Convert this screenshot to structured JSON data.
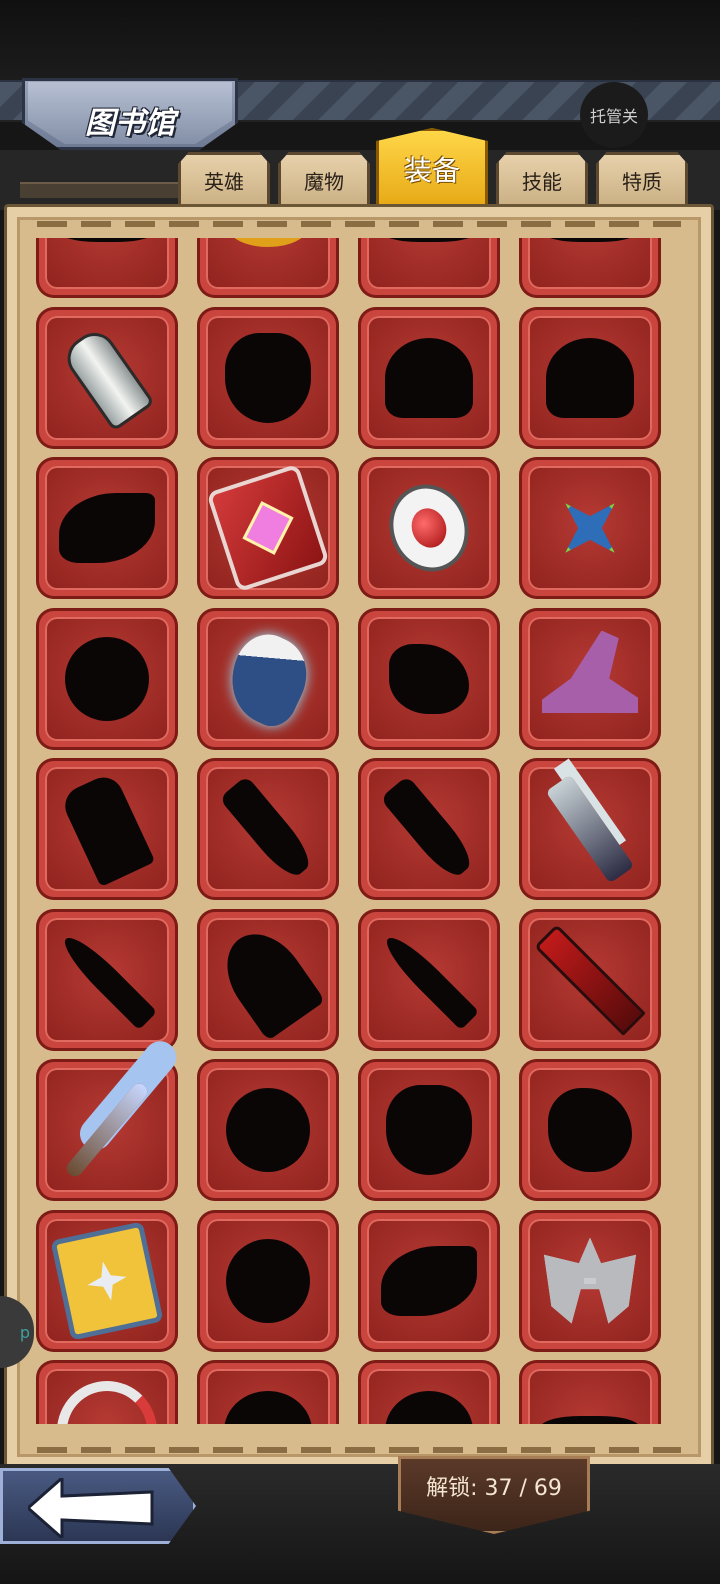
{
  "header": {
    "title": "图书馆",
    "auto_button": "托管关"
  },
  "tabs": [
    {
      "label": "英雄",
      "active": false
    },
    {
      "label": "魔物",
      "active": false
    },
    {
      "label": "装备",
      "active": true
    },
    {
      "label": "技能",
      "active": false
    },
    {
      "label": "特质",
      "active": false
    }
  ],
  "footer": {
    "unlock_label": "解锁: 37 / 69"
  },
  "side_widget": {
    "label": "p"
  },
  "colors": {
    "active_tab": "#f2c12e",
    "tile_red": "#c9453d",
    "panel": "#d8bb8c"
  },
  "grid": {
    "columns": 4,
    "items": [
      {
        "icon": "silhouette-flat",
        "unlocked": false
      },
      {
        "icon": "gold-item",
        "unlocked": true
      },
      {
        "icon": "silhouette-flat",
        "unlocked": false
      },
      {
        "icon": "silhouette-flat",
        "unlocked": false
      },
      {
        "icon": "bell-item",
        "unlocked": true
      },
      {
        "icon": "silhouette-bag",
        "unlocked": false
      },
      {
        "icon": "silhouette-helm",
        "unlocked": false
      },
      {
        "icon": "silhouette-helm",
        "unlocked": false
      },
      {
        "icon": "silhouette-horn",
        "unlocked": false
      },
      {
        "icon": "spellbook-item",
        "unlocked": true
      },
      {
        "icon": "ruby-amulet-item",
        "unlocked": true
      },
      {
        "icon": "shuriken-staff-item",
        "unlocked": true
      },
      {
        "icon": "silhouette-round",
        "unlocked": false
      },
      {
        "icon": "frost-gauntlet-item",
        "unlocked": true
      },
      {
        "icon": "silhouette-glove",
        "unlocked": false
      },
      {
        "icon": "wizard-hat-item",
        "unlocked": true
      },
      {
        "icon": "silhouette-hammer",
        "unlocked": false
      },
      {
        "icon": "silhouette-blade",
        "unlocked": false
      },
      {
        "icon": "silhouette-blade",
        "unlocked": false
      },
      {
        "icon": "skull-scythe-item",
        "unlocked": true
      },
      {
        "icon": "silhouette-spear",
        "unlocked": false
      },
      {
        "icon": "silhouette-axe",
        "unlocked": false
      },
      {
        "icon": "silhouette-spear",
        "unlocked": false
      },
      {
        "icon": "crimson-sword-item",
        "unlocked": true
      },
      {
        "icon": "flower-staff-item",
        "unlocked": true
      },
      {
        "icon": "silhouette-round",
        "unlocked": false
      },
      {
        "icon": "silhouette-bag",
        "unlocked": false
      },
      {
        "icon": "silhouette-blob",
        "unlocked": false
      },
      {
        "icon": "spiked-shield-item",
        "unlocked": true
      },
      {
        "icon": "silhouette-round",
        "unlocked": false
      },
      {
        "icon": "silhouette-horn",
        "unlocked": false
      },
      {
        "icon": "spiked-helmet-item",
        "unlocked": true
      },
      {
        "icon": "hook-item",
        "unlocked": true
      },
      {
        "icon": "silhouette-helm",
        "unlocked": false
      },
      {
        "icon": "silhouette-helm",
        "unlocked": false
      },
      {
        "icon": "silhouette-flat",
        "unlocked": false
      }
    ]
  }
}
